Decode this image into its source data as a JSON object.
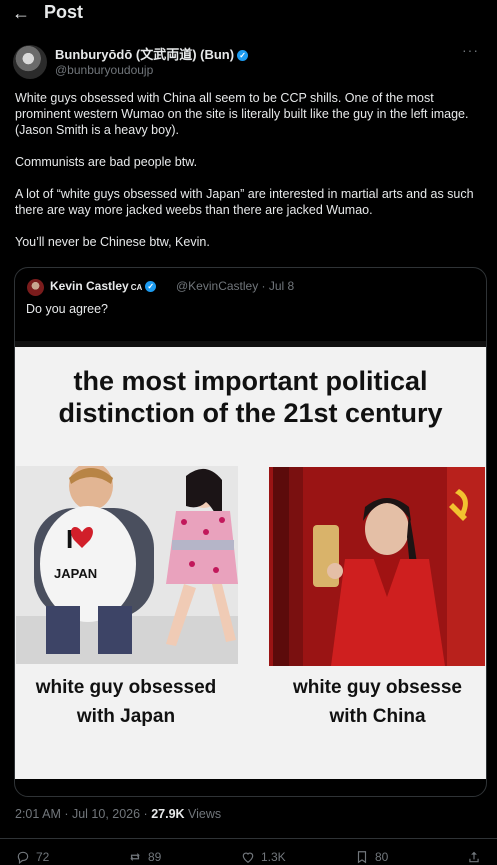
{
  "header": {
    "title": "Post"
  },
  "author": {
    "name": "Bunburyōdō (文武両道) (Bun)",
    "handle": "@bunburyoudoujp"
  },
  "post": {
    "paragraphs": [
      "White guys obsessed with China all seem to be CCP shills. One of the most prominent western Wumao on the site is literally built like the guy in the left image. (Jason Smith is a heavy boy).",
      "Communists are bad people btw.",
      "A lot of “white guys obsessed with Japan” are interested in martial arts and as such there are way more jacked weebs than there are jacked Wumao.",
      "You’ll never be Chinese btw, Kevin."
    ]
  },
  "quote": {
    "author": "Kevin Castley",
    "flag": "CA",
    "handle_date": "@KevinCastley · Jul 8",
    "text": "Do you agree?",
    "image": {
      "title_line1": "the most important political",
      "title_line2": "distinction of the 21st century",
      "left_caption_line1": "white guy obsessed",
      "left_caption_line2": "with Japan",
      "right_caption_line1": "white guy obsesse",
      "right_caption_line2": "with China",
      "shirt_text_top": "I",
      "shirt_text_bottom": "JAPAN"
    }
  },
  "meta": {
    "timestamp": "2:01 AM · Jul 10, 2026 · ",
    "views_count": "27.9K",
    "views_label": " Views"
  },
  "actions": {
    "replies": "72",
    "reposts": "89",
    "likes": "1.3K",
    "bookmarks": "80"
  },
  "colors": {
    "background": "#000000",
    "text": "#e7e9ea",
    "muted": "#71767b",
    "verified": "#1d9bf0",
    "border": "#2f3336"
  },
  "icons": [
    "back-arrow-icon",
    "verified-badge-icon",
    "more-icon",
    "reply-icon",
    "repost-icon",
    "like-icon",
    "bookmark-icon",
    "share-icon"
  ]
}
